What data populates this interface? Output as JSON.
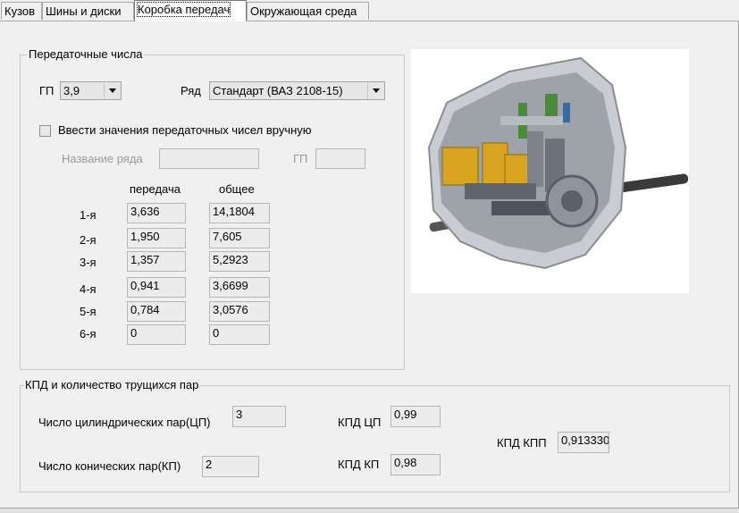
{
  "tabs": [
    "Кузов",
    "Шины и диски",
    "Коробка передач",
    "Окружающая среда"
  ],
  "ratios": {
    "legend": "Передаточные числа",
    "gp_label": "ГП",
    "gp_value": "3,9",
    "series_label": "Ряд",
    "series_value": "Стандарт (ВАЗ 2108-15)",
    "manual_label": "Ввести значения передаточных чисел вручную",
    "manual_checked": false,
    "series_name_label": "Название ряда",
    "series_name_value": "",
    "gp2_label": "ГП",
    "gp2_value": "",
    "col_gear": "передача",
    "col_total": "общее",
    "gears": [
      {
        "label": "1-я",
        "gear": "3,636",
        "total": "14,1804"
      },
      {
        "label": "2-я",
        "gear": "1,950",
        "total": "7,605"
      },
      {
        "label": "3-я",
        "gear": "1,357",
        "total": "5,2923"
      },
      {
        "label": "4-я",
        "gear": "0,941",
        "total": "3,6699"
      },
      {
        "label": "5-я",
        "gear": "0,784",
        "total": "3,0576"
      },
      {
        "label": "6-я",
        "gear": "0",
        "total": "0"
      }
    ]
  },
  "efficiency": {
    "legend": "КПД и количество трущихся пар",
    "cyl_label": "Число цилиндрических пар(ЦП)",
    "cyl_value": "3",
    "con_label": "Число конических пар(КП)",
    "con_value": "2",
    "kpd_cp_label": "КПД ЦП",
    "kpd_cp_value": "0,99",
    "kpd_kp_label": "КПД КП",
    "kpd_kp_value": "0,98",
    "kpd_kpp_label": "КПД КПП",
    "kpd_kpp_value": "0,913330"
  },
  "image": {
    "icon": "gearbox-cutaway-image"
  }
}
